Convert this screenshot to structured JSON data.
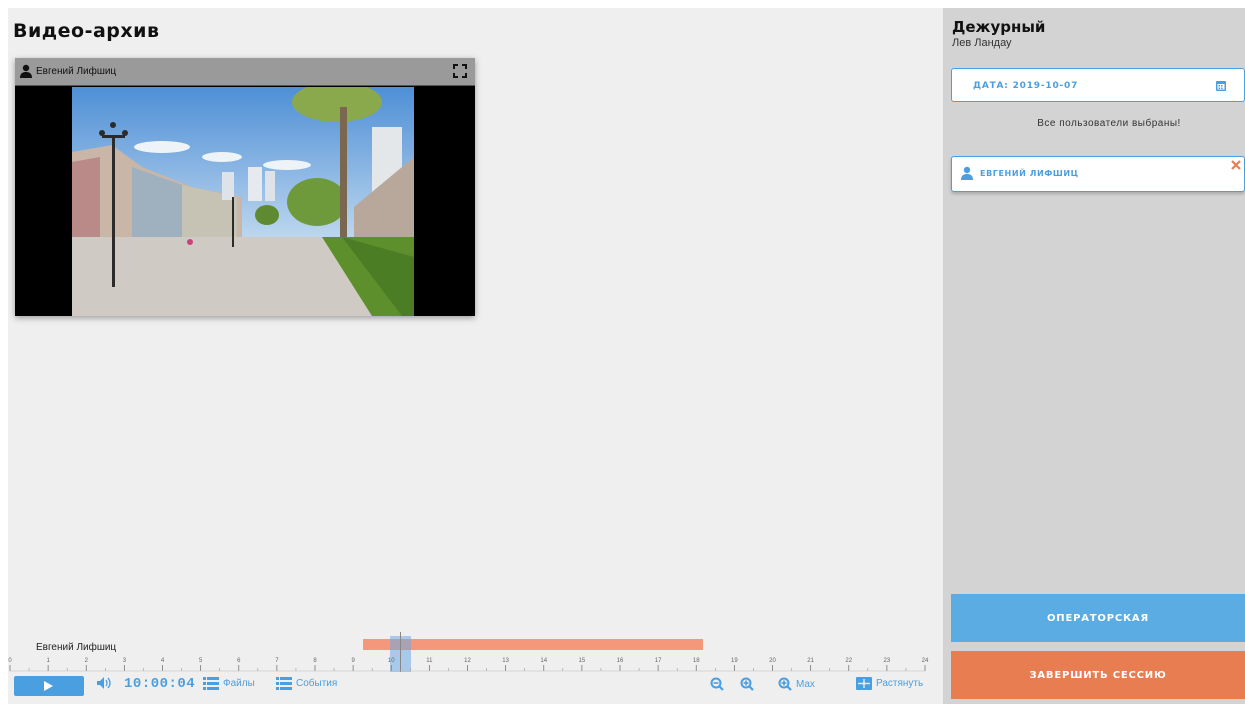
{
  "page": {
    "title": "Видео-архив"
  },
  "video": {
    "camera_user": "Евгений Лифшиц"
  },
  "timeline": {
    "track_name": "Евгений Лифшиц",
    "hours": [
      "0",
      "1",
      "2",
      "3",
      "4",
      "5",
      "6",
      "7",
      "8",
      "9",
      "10",
      "11",
      "12",
      "13",
      "14",
      "15",
      "16",
      "17",
      "18",
      "19",
      "20",
      "21",
      "22",
      "23",
      "24"
    ]
  },
  "controls": {
    "time": "10:00:04",
    "files_label": "Файлы",
    "events_label": "События",
    "max_label": "Max",
    "stretch_label": "Растянуть"
  },
  "sidebar": {
    "title": "Дежурный",
    "user": "Лев Ландау",
    "date_label": "ДАТА: 2019-10-07",
    "all_users_selected": "Все пользователи выбраны!",
    "selected_user": "ЕВГЕНИЙ ЛИФШИЦ",
    "operator_button": "ОПЕРАТОРСКАЯ",
    "end_session_button": "ЗАВЕРШИТЬ СЕССИЮ"
  },
  "colors": {
    "accent": "#4a9fe0",
    "warn": "#e87d52",
    "recorded": "#f4977b"
  }
}
